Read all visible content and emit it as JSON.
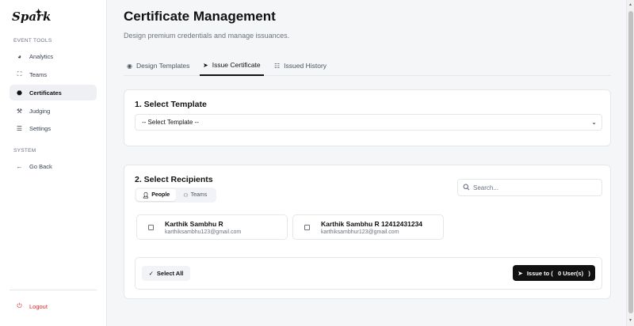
{
  "brand": {
    "name": "Spark",
    "spark_glyph": "✦"
  },
  "sidebar": {
    "event_tools_label": "EVENT TOOLS",
    "items": [
      {
        "label": "Analytics",
        "icon": "pie-chart-icon"
      },
      {
        "label": "Teams",
        "icon": "team-icon"
      },
      {
        "label": "Certificates",
        "icon": "certificate-icon"
      },
      {
        "label": "Judging",
        "icon": "gavel-icon"
      },
      {
        "label": "Settings",
        "icon": "sliders-icon"
      }
    ],
    "system_label": "SYSTEM",
    "go_back_label": "Go Back",
    "logout_label": "Logout"
  },
  "header": {
    "title": "Certificate Management",
    "subtitle": "Design premium credentials and manage issuances."
  },
  "tabs": [
    {
      "label": "Design Templates",
      "icon": "palette-icon"
    },
    {
      "label": "Issue Certificate",
      "icon": "send-icon"
    },
    {
      "label": "Issued History",
      "icon": "list-icon"
    }
  ],
  "template_section": {
    "title": "1. Select Template",
    "select_value": "-- Select Template --"
  },
  "recipients_section": {
    "title": "2. Select Recipients",
    "toggle": {
      "people": "People",
      "teams": "Teams"
    },
    "search_placeholder": "Search...",
    "recipients": [
      {
        "name": "Karthik Sambhu R",
        "email": "karthiksambhu123@gmail.com"
      },
      {
        "name": "Karthik Sambhu R 12412431234",
        "email": "karthiksambhur123@gmail.com"
      }
    ],
    "select_all_label": "Select All",
    "issue_label": "Issue to (   0 User(s)   )"
  },
  "colors": {
    "accent": "#111111",
    "danger": "#dc2626",
    "muted": "#6b7280"
  }
}
